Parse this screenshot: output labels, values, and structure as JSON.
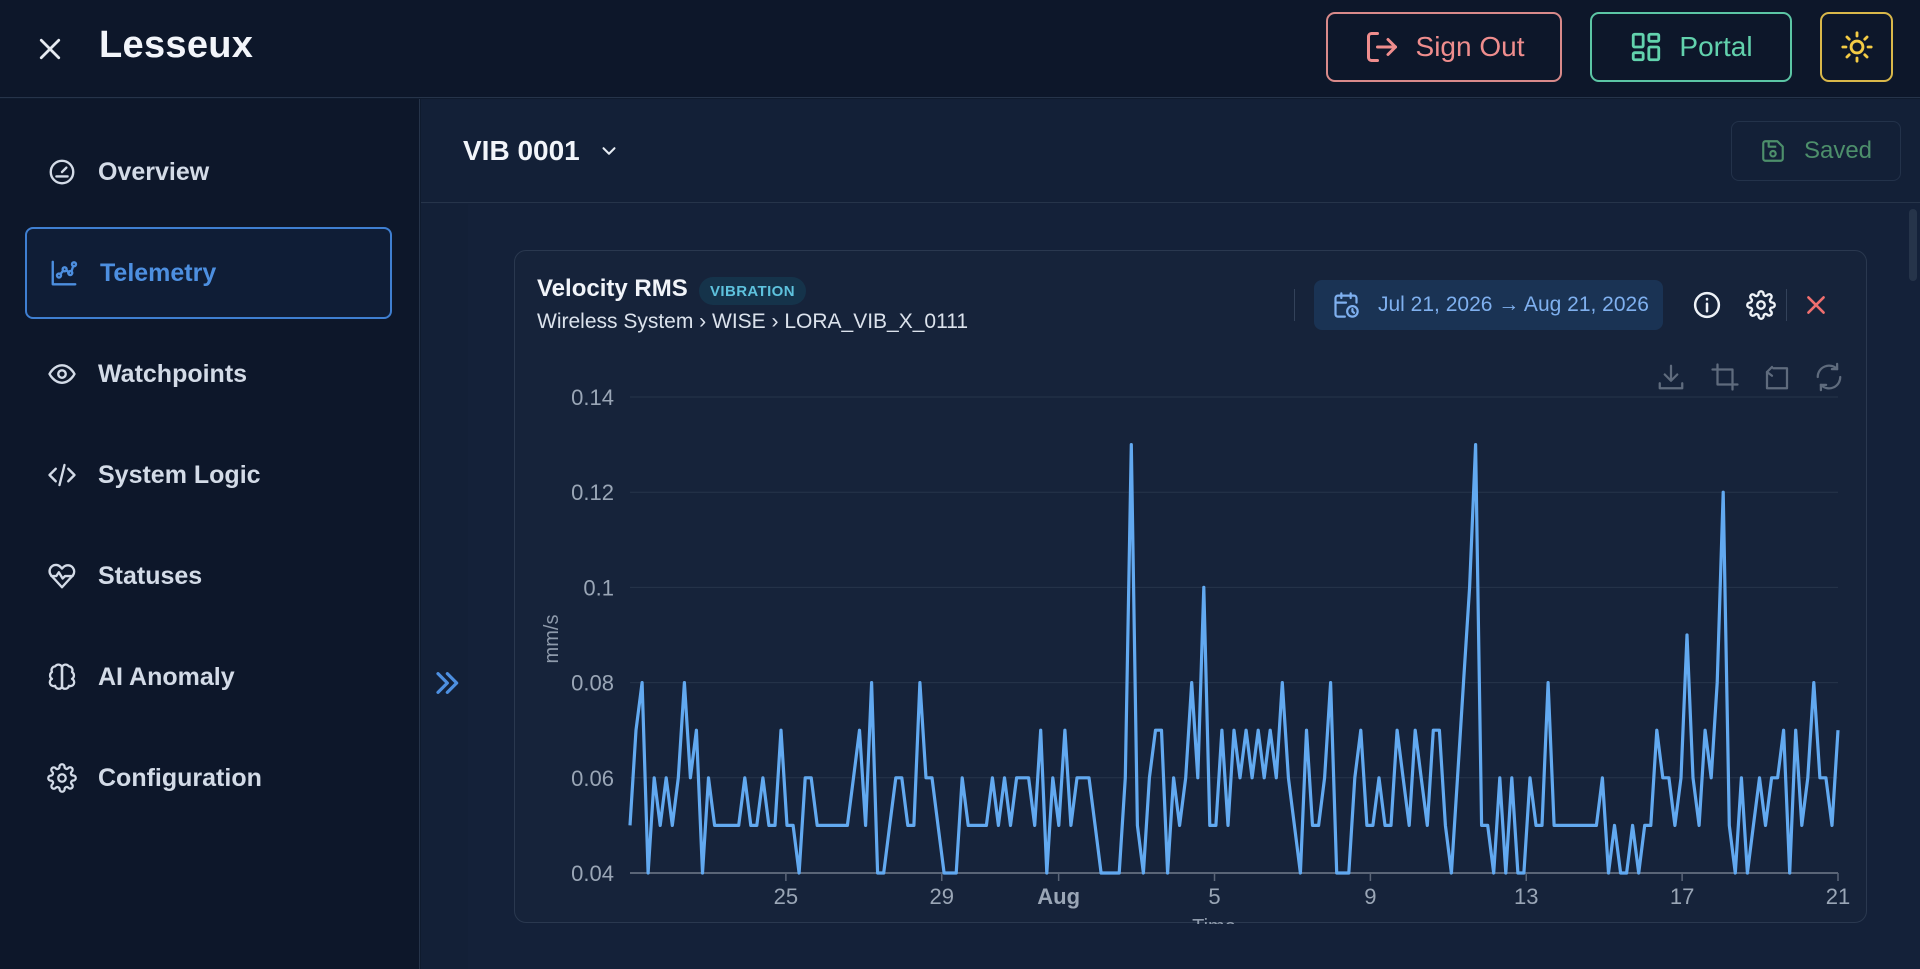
{
  "app": {
    "brand": "Lesseux"
  },
  "header": {
    "sign_out_label": "Sign Out",
    "portal_label": "Portal"
  },
  "sidebar": {
    "items": [
      {
        "label": "Overview",
        "icon": "gauge-icon",
        "active": false
      },
      {
        "label": "Telemetry",
        "icon": "chart-line-icon",
        "active": true
      },
      {
        "label": "Watchpoints",
        "icon": "eye-icon",
        "active": false
      },
      {
        "label": "System Logic",
        "icon": "code-icon",
        "active": false
      },
      {
        "label": "Statuses",
        "icon": "heart-pulse-icon",
        "active": false
      },
      {
        "label": "AI Anomaly",
        "icon": "brain-icon",
        "active": false
      },
      {
        "label": "Configuration",
        "icon": "gear-icon",
        "active": false
      }
    ]
  },
  "subheader": {
    "device": "VIB 0001",
    "saved_label": "Saved"
  },
  "card": {
    "title": "Velocity RMS",
    "badge": "VIBRATION",
    "breadcrumb": "Wireless System › WISE › LORA_VIB_X_0111",
    "date_range": "Jul 21, 2026 → Aug 21, 2026"
  },
  "colors": {
    "accent": "#4d8fe0",
    "series": "#62a9f0",
    "sign_out": "#ef8d8d",
    "portal": "#62d2ad",
    "theme": "#f3cb45",
    "saved": "#4d8f6b"
  },
  "chart_data": {
    "type": "line",
    "title": "",
    "xlabel": "Time",
    "ylabel": "mm/s",
    "ylim": [
      0.04,
      0.14
    ],
    "yticks": [
      "0.14",
      "0.12",
      "0.1",
      "0.08",
      "0.06",
      "0.04"
    ],
    "xlim": [
      "2026-07-21",
      "2026-08-21"
    ],
    "xticks": [
      {
        "label": "25",
        "date": "2026-07-25"
      },
      {
        "label": "29",
        "date": "2026-07-29"
      },
      {
        "label": "Aug",
        "date": "2026-08-01",
        "bold": true
      },
      {
        "label": "5",
        "date": "2026-08-05"
      },
      {
        "label": "9",
        "date": "2026-08-09"
      },
      {
        "label": "13",
        "date": "2026-08-13"
      },
      {
        "label": "17",
        "date": "2026-08-17"
      },
      {
        "label": "21",
        "date": "2026-08-21"
      }
    ],
    "grid": true,
    "data_zoom": true,
    "series": [
      {
        "values": [
          0.05,
          0.07,
          0.08,
          0.04,
          0.06,
          0.05,
          0.06,
          0.05,
          0.06,
          0.08,
          0.06,
          0.07,
          0.04,
          0.06,
          0.05,
          0.05,
          0.05,
          0.05,
          0.05,
          0.06,
          0.05,
          0.05,
          0.06,
          0.05,
          0.05,
          0.07,
          0.05,
          0.05,
          0.04,
          0.06,
          0.06,
          0.05,
          0.05,
          0.05,
          0.05,
          0.05,
          0.05,
          0.06,
          0.07,
          0.05,
          0.08,
          0.04,
          0.04,
          0.05,
          0.06,
          0.06,
          0.05,
          0.05,
          0.08,
          0.06,
          0.06,
          0.05,
          0.04,
          0.04,
          0.04,
          0.06,
          0.05,
          0.05,
          0.05,
          0.05,
          0.06,
          0.05,
          0.06,
          0.05,
          0.06,
          0.06,
          0.06,
          0.05,
          0.07,
          0.04,
          0.06,
          0.05,
          0.07,
          0.05,
          0.06,
          0.06,
          0.06,
          0.05,
          0.04,
          0.04,
          0.04,
          0.04,
          0.06,
          0.13,
          0.05,
          0.04,
          0.06,
          0.07,
          0.07,
          0.04,
          0.06,
          0.05,
          0.06,
          0.08,
          0.06,
          0.1,
          0.05,
          0.05,
          0.07,
          0.05,
          0.07,
          0.06,
          0.07,
          0.06,
          0.07,
          0.06,
          0.07,
          0.06,
          0.08,
          0.06,
          0.05,
          0.04,
          0.07,
          0.05,
          0.05,
          0.06,
          0.08,
          0.04,
          0.04,
          0.04,
          0.06,
          0.07,
          0.05,
          0.05,
          0.06,
          0.05,
          0.05,
          0.07,
          0.06,
          0.05,
          0.07,
          0.06,
          0.05,
          0.07,
          0.07,
          0.05,
          0.04,
          0.06,
          0.08,
          0.1,
          0.13,
          0.05,
          0.05,
          0.04,
          0.06,
          0.04,
          0.06,
          0.04,
          0.04,
          0.06,
          0.05,
          0.05,
          0.08,
          0.05,
          0.05,
          0.05,
          0.05,
          0.05,
          0.05,
          0.05,
          0.05,
          0.06,
          0.04,
          0.05,
          0.04,
          0.04,
          0.05,
          0.04,
          0.05,
          0.05,
          0.07,
          0.06,
          0.06,
          0.05,
          0.06,
          0.09,
          0.06,
          0.05,
          0.07,
          0.06,
          0.08,
          0.12,
          0.05,
          0.04,
          0.06,
          0.04,
          0.05,
          0.06,
          0.05,
          0.06,
          0.06,
          0.07,
          0.04,
          0.07,
          0.05,
          0.06,
          0.08,
          0.06,
          0.06,
          0.05,
          0.07
        ]
      }
    ]
  }
}
